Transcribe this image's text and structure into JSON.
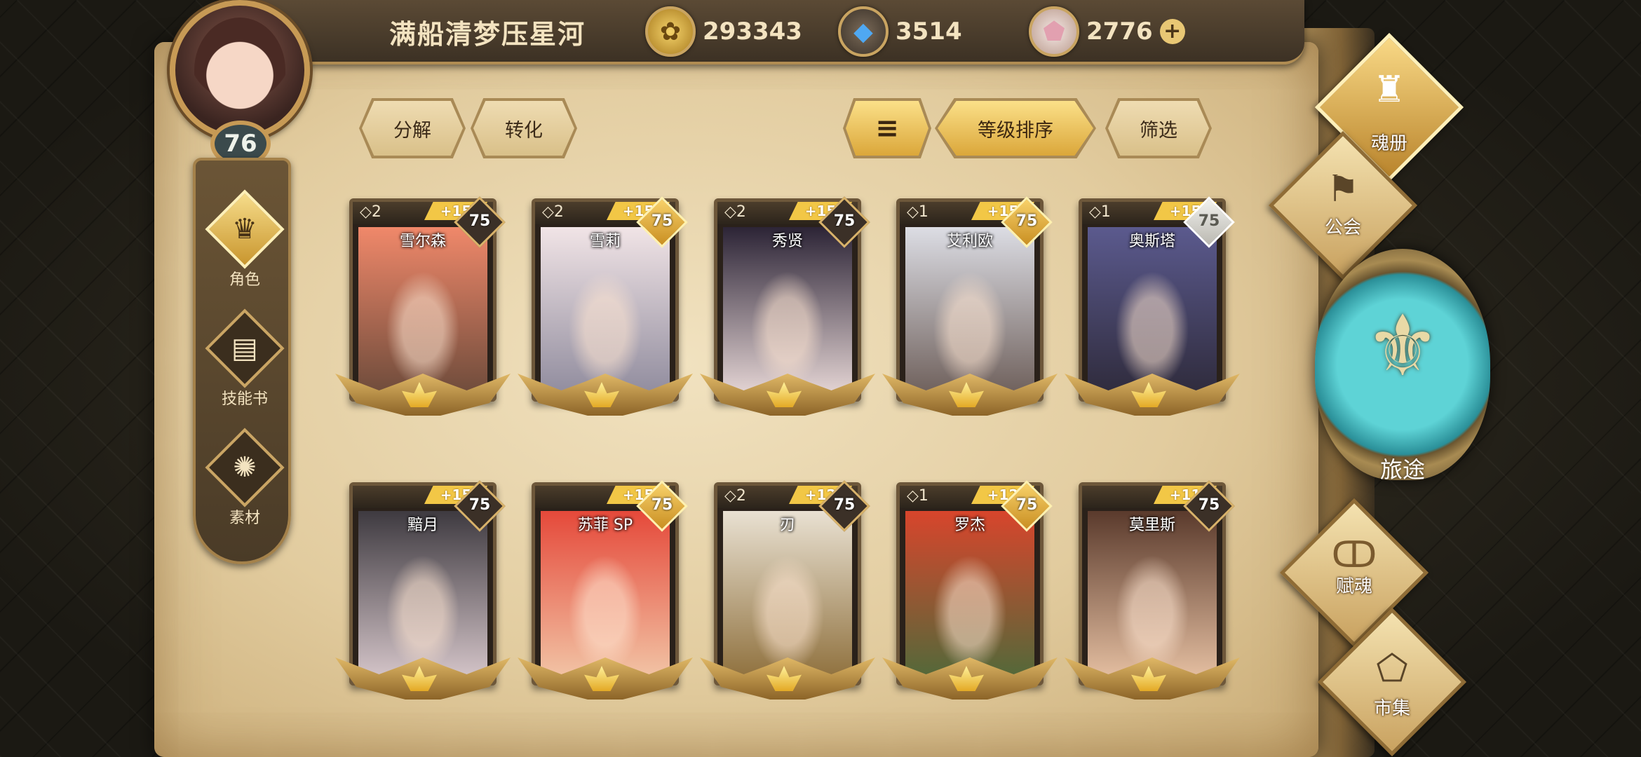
{
  "player": {
    "name": "满船清梦压星河",
    "level": "76"
  },
  "currencies": [
    {
      "icon": "gold-coin-icon",
      "value": "293343"
    },
    {
      "icon": "blue-crystal-icon",
      "value": "3514"
    },
    {
      "icon": "pink-gem-icon",
      "value": "2776",
      "plus": "+"
    }
  ],
  "sidebar": {
    "items": [
      {
        "label": "角色",
        "icon": "character-icon",
        "active": true
      },
      {
        "label": "技能书",
        "icon": "skill-book-icon"
      },
      {
        "label": "素材",
        "icon": "material-icon"
      }
    ]
  },
  "actions": {
    "decompose": "分解",
    "convert": "转化",
    "sort_icon": "≡",
    "sort_level": "等级排序",
    "filter": "筛选"
  },
  "heroes": [
    {
      "name": "雪尔森",
      "stars": "◇2",
      "plus": "+15",
      "level": "75",
      "badge": "dark",
      "colors": [
        "#f0886a",
        "#6b4a3a"
      ]
    },
    {
      "name": "雪莉",
      "stars": "◇2",
      "plus": "+15",
      "level": "75",
      "badge": "gold",
      "colors": [
        "#f1e4e6",
        "#8e8a9c"
      ]
    },
    {
      "name": "秀贤",
      "stars": "◇2",
      "plus": "+15",
      "level": "75",
      "badge": "dark",
      "colors": [
        "#2c2436",
        "#e9d9d8"
      ]
    },
    {
      "name": "艾利欧",
      "stars": "◇1",
      "plus": "+15",
      "level": "75",
      "badge": "gold",
      "colors": [
        "#dcdde4",
        "#6c5d58"
      ]
    },
    {
      "name": "奥斯塔",
      "stars": "◇1",
      "plus": "+15",
      "level": "75",
      "badge": "silver",
      "colors": [
        "#5b5a8e",
        "#2e2a3a"
      ]
    },
    {
      "name": "黯月",
      "stars": "",
      "plus": "+15",
      "level": "75",
      "badge": "dark",
      "colors": [
        "#3e3a40",
        "#d8c8cc"
      ]
    },
    {
      "name": "苏菲 SP",
      "stars": "",
      "plus": "+15",
      "level": "75",
      "badge": "gold",
      "colors": [
        "#e5493a",
        "#f2c7a8"
      ]
    },
    {
      "name": "刃",
      "stars": "◇2",
      "plus": "+12",
      "level": "75",
      "badge": "dark",
      "colors": [
        "#e9e1d2",
        "#8d6e3a"
      ]
    },
    {
      "name": "罗杰",
      "stars": "◇1",
      "plus": "+12",
      "level": "75",
      "badge": "gold",
      "colors": [
        "#d8452c",
        "#4f6a3a"
      ]
    },
    {
      "name": "莫里斯",
      "stars": "",
      "plus": "+11",
      "level": "75",
      "badge": "dark",
      "colors": [
        "#5a3a2c",
        "#e8c2a4"
      ]
    }
  ],
  "right_menu": {
    "soul_book": "魂册",
    "guild": "公会",
    "journey": "旅途",
    "soul_gift": "赋魂",
    "market": "市集"
  }
}
